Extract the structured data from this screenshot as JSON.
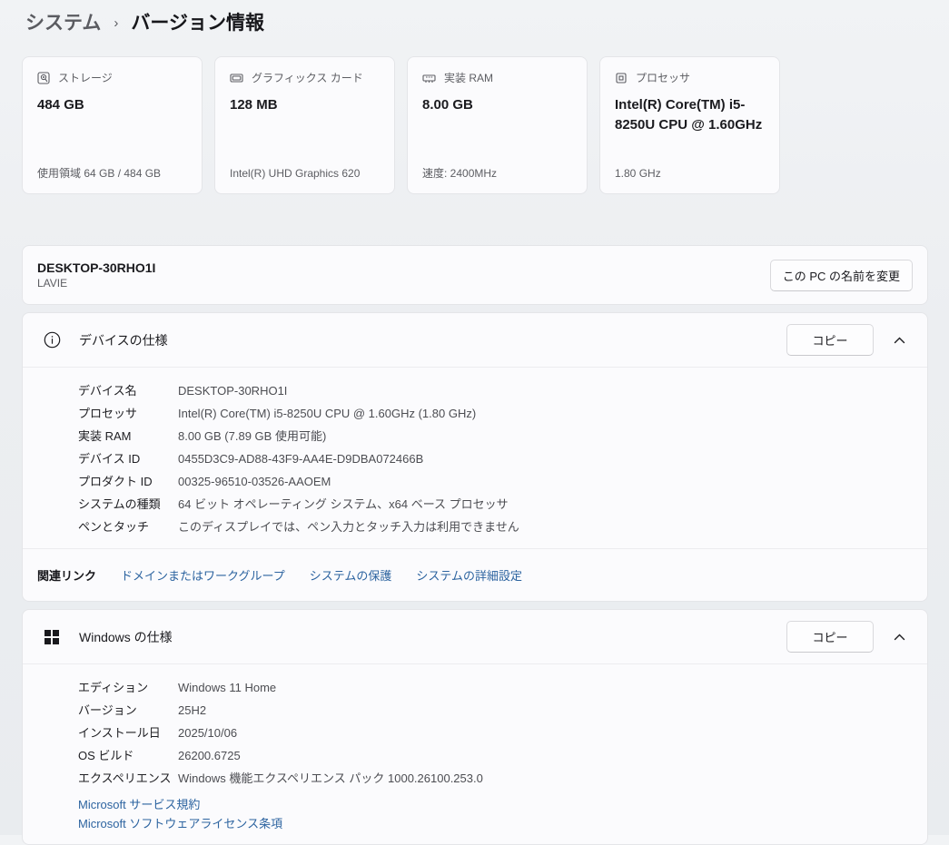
{
  "breadcrumb": {
    "parent": "システム",
    "separator": "›",
    "current": "バージョン情報"
  },
  "summary_cards": [
    {
      "icon": "storage-icon",
      "label": "ストレージ",
      "value": "484 GB",
      "detail": "使用領域 64 GB / 484 GB"
    },
    {
      "icon": "graphics-card-icon",
      "label": "グラフィックス カード",
      "value": "128 MB",
      "detail": "Intel(R) UHD Graphics 620"
    },
    {
      "icon": "ram-icon",
      "label": "実装 RAM",
      "value": "8.00 GB",
      "detail": "速度: 2400MHz"
    },
    {
      "icon": "cpu-icon",
      "label": "プロセッサ",
      "value": "Intel(R) Core(TM) i5-8250U CPU @ 1.60GHz",
      "detail": "1.80 GHz"
    }
  ],
  "device_name": {
    "name": "DESKTOP-30RHO1I",
    "model": "LAVIE",
    "rename_button": "この PC の名前を変更"
  },
  "device_spec": {
    "title": "デバイスの仕様",
    "copy_button": "コピー",
    "rows": [
      {
        "label": "デバイス名",
        "value": "DESKTOP-30RHO1I"
      },
      {
        "label": "プロセッサ",
        "value": "Intel(R) Core(TM) i5-8250U CPU @ 1.60GHz (1.80 GHz)"
      },
      {
        "label": "実装 RAM",
        "value": "8.00 GB (7.89 GB 使用可能)"
      },
      {
        "label": "デバイス ID",
        "value": "0455D3C9-AD88-43F9-AA4E-D9DBA072466B"
      },
      {
        "label": "プロダクト ID",
        "value": "00325-96510-03526-AAOEM"
      },
      {
        "label": "システムの種類",
        "value": "64 ビット オペレーティング システム、x64 ベース プロセッサ"
      },
      {
        "label": "ペンとタッチ",
        "value": "このディスプレイでは、ペン入力とタッチ入力は利用できません"
      }
    ],
    "related": {
      "label": "関連リンク",
      "links": [
        "ドメインまたはワークグループ",
        "システムの保護",
        "システムの詳細設定"
      ]
    }
  },
  "windows_spec": {
    "title": "Windows の仕様",
    "copy_button": "コピー",
    "rows": [
      {
        "label": "エディション",
        "value": "Windows 11 Home"
      },
      {
        "label": "バージョン",
        "value": "25H2"
      },
      {
        "label": "インストール日",
        "value": "2025/10/06"
      },
      {
        "label": "OS ビルド",
        "value": "26200.6725"
      },
      {
        "label": "エクスペリエンス",
        "value": "Windows 機能エクスペリエンス パック 1000.26100.253.0"
      }
    ],
    "links": [
      "Microsoft サービス規約",
      "Microsoft ソフトウェアライセンス条項"
    ]
  },
  "colors": {
    "link": "#2d64a0",
    "card_bg": "#fbfbfd",
    "page_bg": "#edeff2"
  }
}
